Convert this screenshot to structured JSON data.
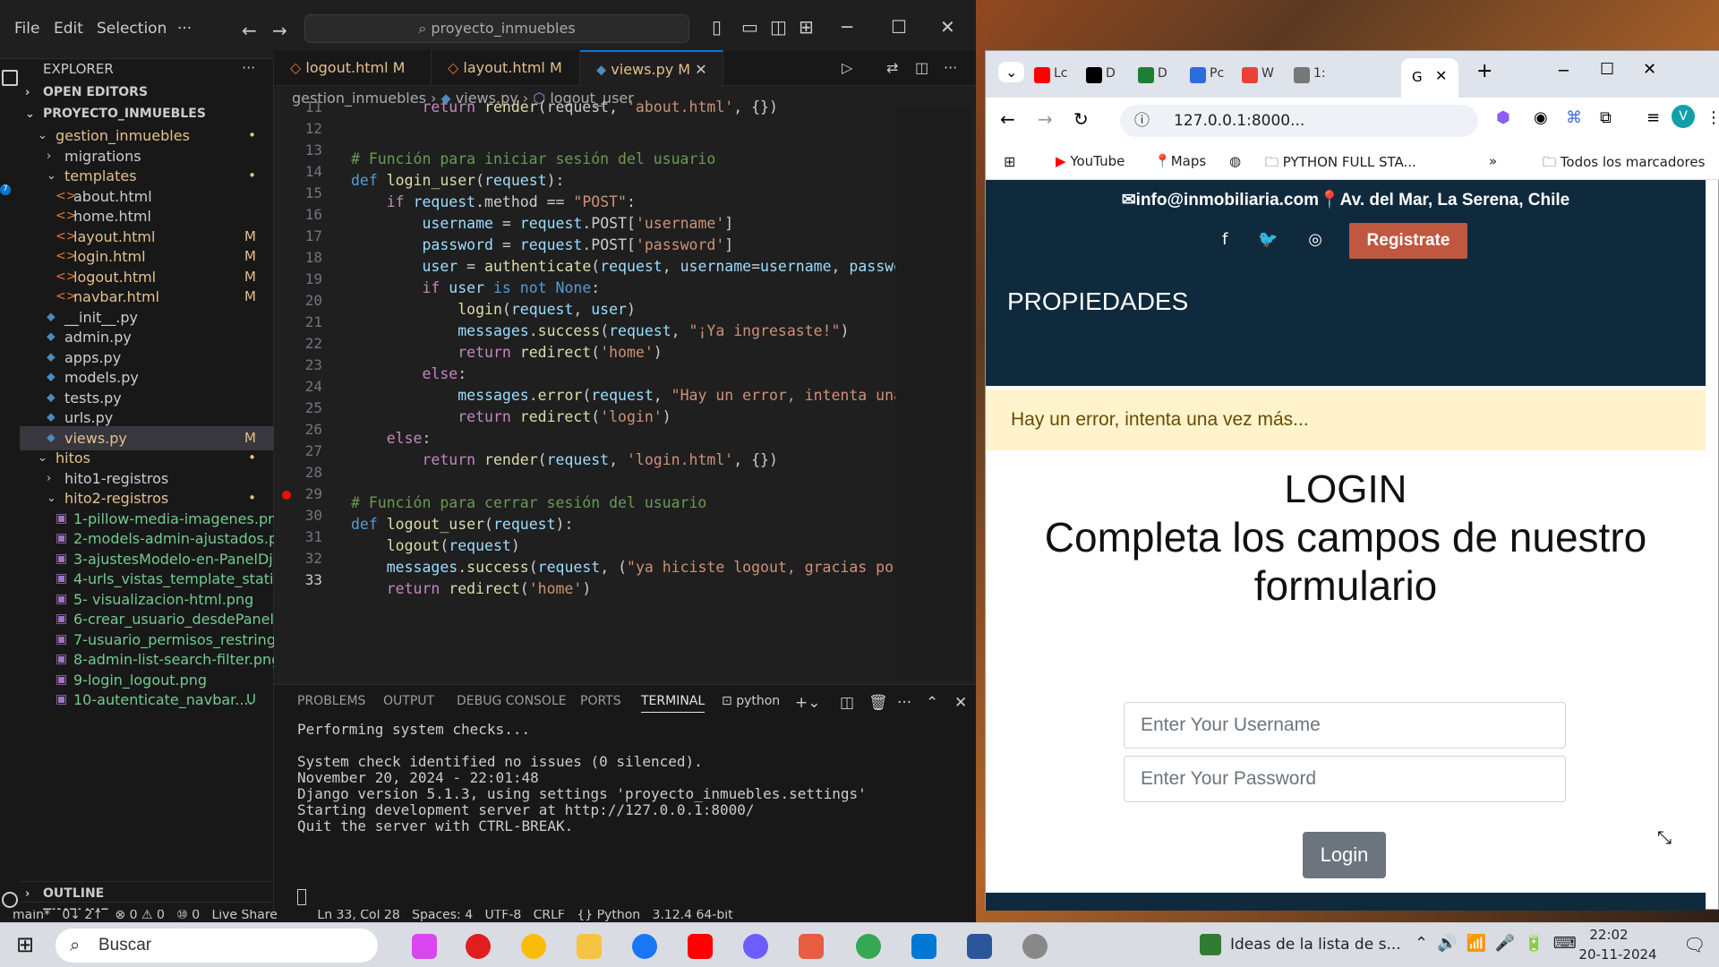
{
  "vscode": {
    "menu": [
      "File",
      "Edit",
      "Selection",
      "···"
    ],
    "search_text": "proyecto_inmuebles",
    "explorer_title": "EXPLORER",
    "open_editors": "OPEN EDITORS",
    "project": "PROYECTO_INMUEBLES",
    "tree": [
      {
        "label": "gestion_inmuebles",
        "type": "folder",
        "indent": 1,
        "badge": "•"
      },
      {
        "label": "migrations",
        "type": "folder-closed",
        "indent": 2,
        "badge": ""
      },
      {
        "label": "templates",
        "type": "folder",
        "indent": 2,
        "badge": "•"
      },
      {
        "label": "about.html",
        "type": "html",
        "indent": 3,
        "badge": ""
      },
      {
        "label": "home.html",
        "type": "html",
        "indent": 3,
        "badge": ""
      },
      {
        "label": "layout.html",
        "type": "html",
        "indent": 3,
        "badge": "M"
      },
      {
        "label": "login.html",
        "type": "html",
        "indent": 3,
        "badge": "M"
      },
      {
        "label": "logout.html",
        "type": "html",
        "indent": 3,
        "badge": "M"
      },
      {
        "label": "navbar.html",
        "type": "html",
        "indent": 3,
        "badge": "M"
      },
      {
        "label": "__init__.py",
        "type": "py",
        "indent": 2,
        "badge": ""
      },
      {
        "label": "admin.py",
        "type": "py",
        "indent": 2,
        "badge": ""
      },
      {
        "label": "apps.py",
        "type": "py",
        "indent": 2,
        "badge": ""
      },
      {
        "label": "models.py",
        "type": "py",
        "indent": 2,
        "badge": ""
      },
      {
        "label": "tests.py",
        "type": "py",
        "indent": 2,
        "badge": ""
      },
      {
        "label": "urls.py",
        "type": "py",
        "indent": 2,
        "badge": ""
      },
      {
        "label": "views.py",
        "type": "py",
        "indent": 2,
        "badge": "M"
      },
      {
        "label": "hitos",
        "type": "folder",
        "indent": 1,
        "badge": "•"
      },
      {
        "label": "hito1-registros",
        "type": "folder-closed",
        "indent": 2,
        "badge": ""
      },
      {
        "label": "hito2-registros",
        "type": "folder",
        "indent": 2,
        "badge": "•"
      },
      {
        "label": "1-pillow-media-imagenes.png",
        "type": "png",
        "indent": 3,
        "badge": ""
      },
      {
        "label": "2-models-admin-ajustados.p...",
        "type": "png",
        "indent": 3,
        "badge": ""
      },
      {
        "label": "3-ajustesModelo-en-PanelDj...",
        "type": "png",
        "indent": 3,
        "badge": ""
      },
      {
        "label": "4-urls_vistas_template_static....",
        "type": "png",
        "indent": 3,
        "badge": ""
      },
      {
        "label": "5- visualizacion-html.png",
        "type": "png",
        "indent": 3,
        "badge": ""
      },
      {
        "label": "6-crear_usuario_desdePaneld...",
        "type": "png",
        "indent": 3,
        "badge": ""
      },
      {
        "label": "7-usuario_permisos_restringi...",
        "type": "png",
        "indent": 3,
        "badge": ""
      },
      {
        "label": "8-admin-list-search-filter.png",
        "type": "png",
        "indent": 3,
        "badge": ""
      },
      {
        "label": "9-login_logout.png",
        "type": "png",
        "indent": 3,
        "badge": ""
      },
      {
        "label": "10-autenticate_navbar....",
        "type": "png",
        "indent": 3,
        "badge": "U"
      }
    ],
    "outline": "OUTLINE",
    "timeline": "TIMELINE",
    "tabs": [
      {
        "label": "logout.html",
        "badge": "M"
      },
      {
        "label": "layout.html",
        "badge": "M"
      },
      {
        "label": "views.py",
        "badge": "M"
      }
    ],
    "breadcrumb": [
      "gestion_inmuebles",
      "views.py",
      "logout_user"
    ],
    "line_numbers": [
      "11",
      "12",
      "13",
      "14",
      "15",
      "16",
      "17",
      "18",
      "19",
      "20",
      "21",
      "22",
      "23",
      "24",
      "25",
      "26",
      "27",
      "28",
      "29",
      "30",
      "31",
      "32",
      "33"
    ],
    "panel_tabs": [
      "PROBLEMS",
      "OUTPUT",
      "DEBUG CONSOLE",
      "PORTS",
      "TERMINAL"
    ],
    "terminal_label": "python",
    "terminal_lines": [
      "Performing system checks...",
      "",
      "System check identified no issues (0 silenced).",
      "November 20, 2024 - 22:01:48",
      "Django version 5.1.3, using settings 'proyecto_inmuebles.settings'",
      "Starting development server at http://127.0.0.1:8000/",
      "Quit the server with CTRL-BREAK."
    ],
    "status": "main*   0↓ 2↑   ⊗ 0 ⚠ 0   ⑩ 0   Live Share          Ln 33, Col 28   Spaces: 4   UTF-8   CRLF   {} Python   3.12.4 64-bit"
  },
  "chrome": {
    "tabs": [
      {
        "label": "Lc",
        "color": "#ff0000"
      },
      {
        "label": "D",
        "color": "#000000"
      },
      {
        "label": "D",
        "color": "#1e7e34"
      },
      {
        "label": "Pc",
        "color": "#2d6cdf"
      },
      {
        "label": "W",
        "color": "#ea4335"
      },
      {
        "label": "1:",
        "color": "#777777"
      }
    ],
    "active_tab": "G",
    "url": "127.0.0.1:8000...",
    "bookmarks": [
      "YouTube",
      "Maps",
      "PYTHON FULL STA...",
      "Todos los marcadores"
    ],
    "profile_letter": "V"
  },
  "site": {
    "contact": "✉info@inmobiliaria.com📍Av. del Mar, La Serena, Chile",
    "social": "f 🐦 ◎ ⓟ",
    "register": "Registrate",
    "brand": "PROPIEDADES",
    "alert": "Hay un error, intenta una vez más...",
    "login_title": "LOGIN",
    "login_subtitle": "Completa los campos de nuestro formulario",
    "username_placeholder": "Enter Your Username",
    "password_placeholder": "Enter Your Password",
    "login_button": "Login"
  },
  "taskbar": {
    "search": "Buscar",
    "notification_text": "Ideas de la lista de s...",
    "time": "22:02",
    "date": "20-11-2024"
  }
}
